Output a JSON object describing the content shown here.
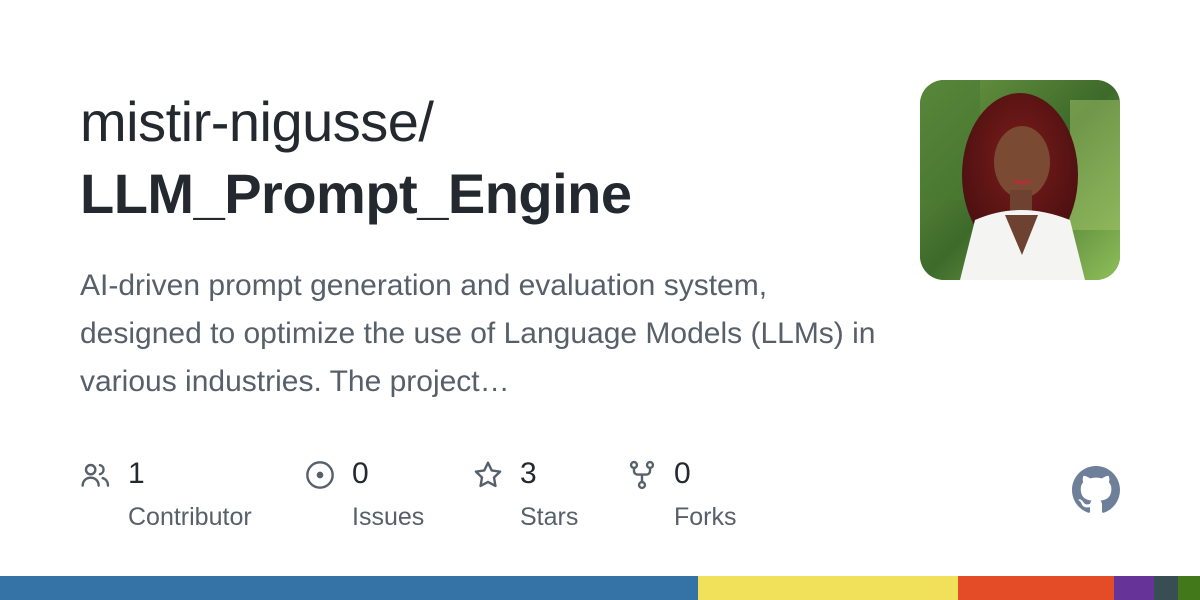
{
  "repo": {
    "owner": "mistir-nigusse/",
    "name": "LLM_Prompt_Engine",
    "description": "AI-driven prompt generation and evaluation system, designed to optimize the use of Language Models (LLMs) in various industries. The project…"
  },
  "avatar": {
    "icon": "profile-photo"
  },
  "stats": [
    {
      "icon": "people-icon",
      "count": "1",
      "label": "Contributor"
    },
    {
      "icon": "issue-opened-icon",
      "count": "0",
      "label": "Issues"
    },
    {
      "icon": "star-icon",
      "count": "3",
      "label": "Stars"
    },
    {
      "icon": "repo-forked-icon",
      "count": "0",
      "label": "Forks"
    }
  ],
  "brand": {
    "logo": "github-mark-icon",
    "logo_color": "#6e7f9a"
  },
  "colors": {
    "text_primary": "#24292f",
    "text_secondary": "#57606a",
    "icon": "#57606a"
  },
  "language_bar": [
    {
      "color": "#3572A5",
      "fraction": 0.5817
    },
    {
      "color": "#F1E05A",
      "fraction": 0.2167
    },
    {
      "color": "#E34C26",
      "fraction": 0.13
    },
    {
      "color": "#663399",
      "fraction": 0.0333
    },
    {
      "color": "#384D54",
      "fraction": 0.02
    },
    {
      "color": "#427819",
      "fraction": 0.0183
    }
  ]
}
